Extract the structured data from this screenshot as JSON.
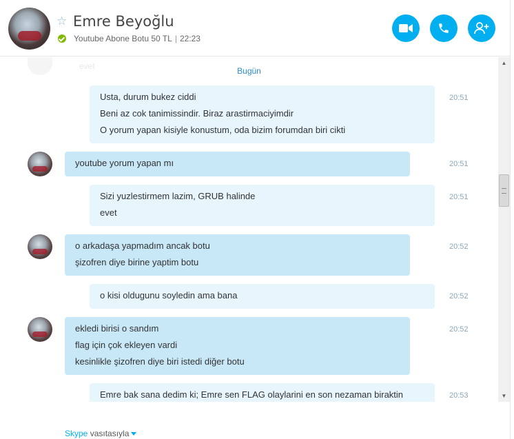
{
  "contact": {
    "name": "Emre Beyoğlu",
    "mood": "Youtube Abone Botu 50 TL",
    "time": "22:23",
    "status": "online"
  },
  "header_buttons": [
    {
      "icon": "video-call-icon"
    },
    {
      "icon": "phone-call-icon"
    },
    {
      "icon": "add-contact-icon"
    }
  ],
  "chat": {
    "ghost_text": "evet",
    "day_separator": "Bugün",
    "messages": [
      {
        "side": "mine",
        "time": "20:51",
        "lines": [
          "Usta, durum bukez ciddi",
          "Beni az cok tanimissindir. Biraz arastirmaciyimdir",
          "O yorum yapan kisiyle konustum, oda bizim forumdan biri cikti"
        ]
      },
      {
        "side": "theirs",
        "time": "20:51",
        "lines": [
          "youtube yorum yapan mı"
        ]
      },
      {
        "side": "mine",
        "time": "20:51",
        "lines": [
          "Sizi yuzlestirmem lazim, GRUB halinde",
          "evet"
        ]
      },
      {
        "side": "theirs",
        "time": "20:52",
        "lines": [
          "o arkadaşa yapmadım ancak botu",
          "şizofren diye birine yaptim botu"
        ]
      },
      {
        "side": "mine",
        "time": "20:52",
        "lines": [
          "o kisi oldugunu soyledin ama bana"
        ]
      },
      {
        "side": "theirs",
        "time": "20:52",
        "lines": [
          "ekledi birisi o sandım",
          "flag için çok ekleyen vardi",
          "kesinlikle şizofren diye biri istedi diğer botu"
        ]
      },
      {
        "side": "mine",
        "time": "20:53",
        "lines": [
          "Emre bak sana dedim ki;  Emre sen FLAG olaylarini en son nezaman biraktin"
        ]
      }
    ]
  },
  "footer": {
    "brand": "Skype",
    "suffix": " vasıtasıyla"
  },
  "colors": {
    "accent": "#00aff0",
    "online": "#7fba00",
    "bubble_mine": "#e7f5fd",
    "bubble_theirs": "#c8e8f8"
  }
}
